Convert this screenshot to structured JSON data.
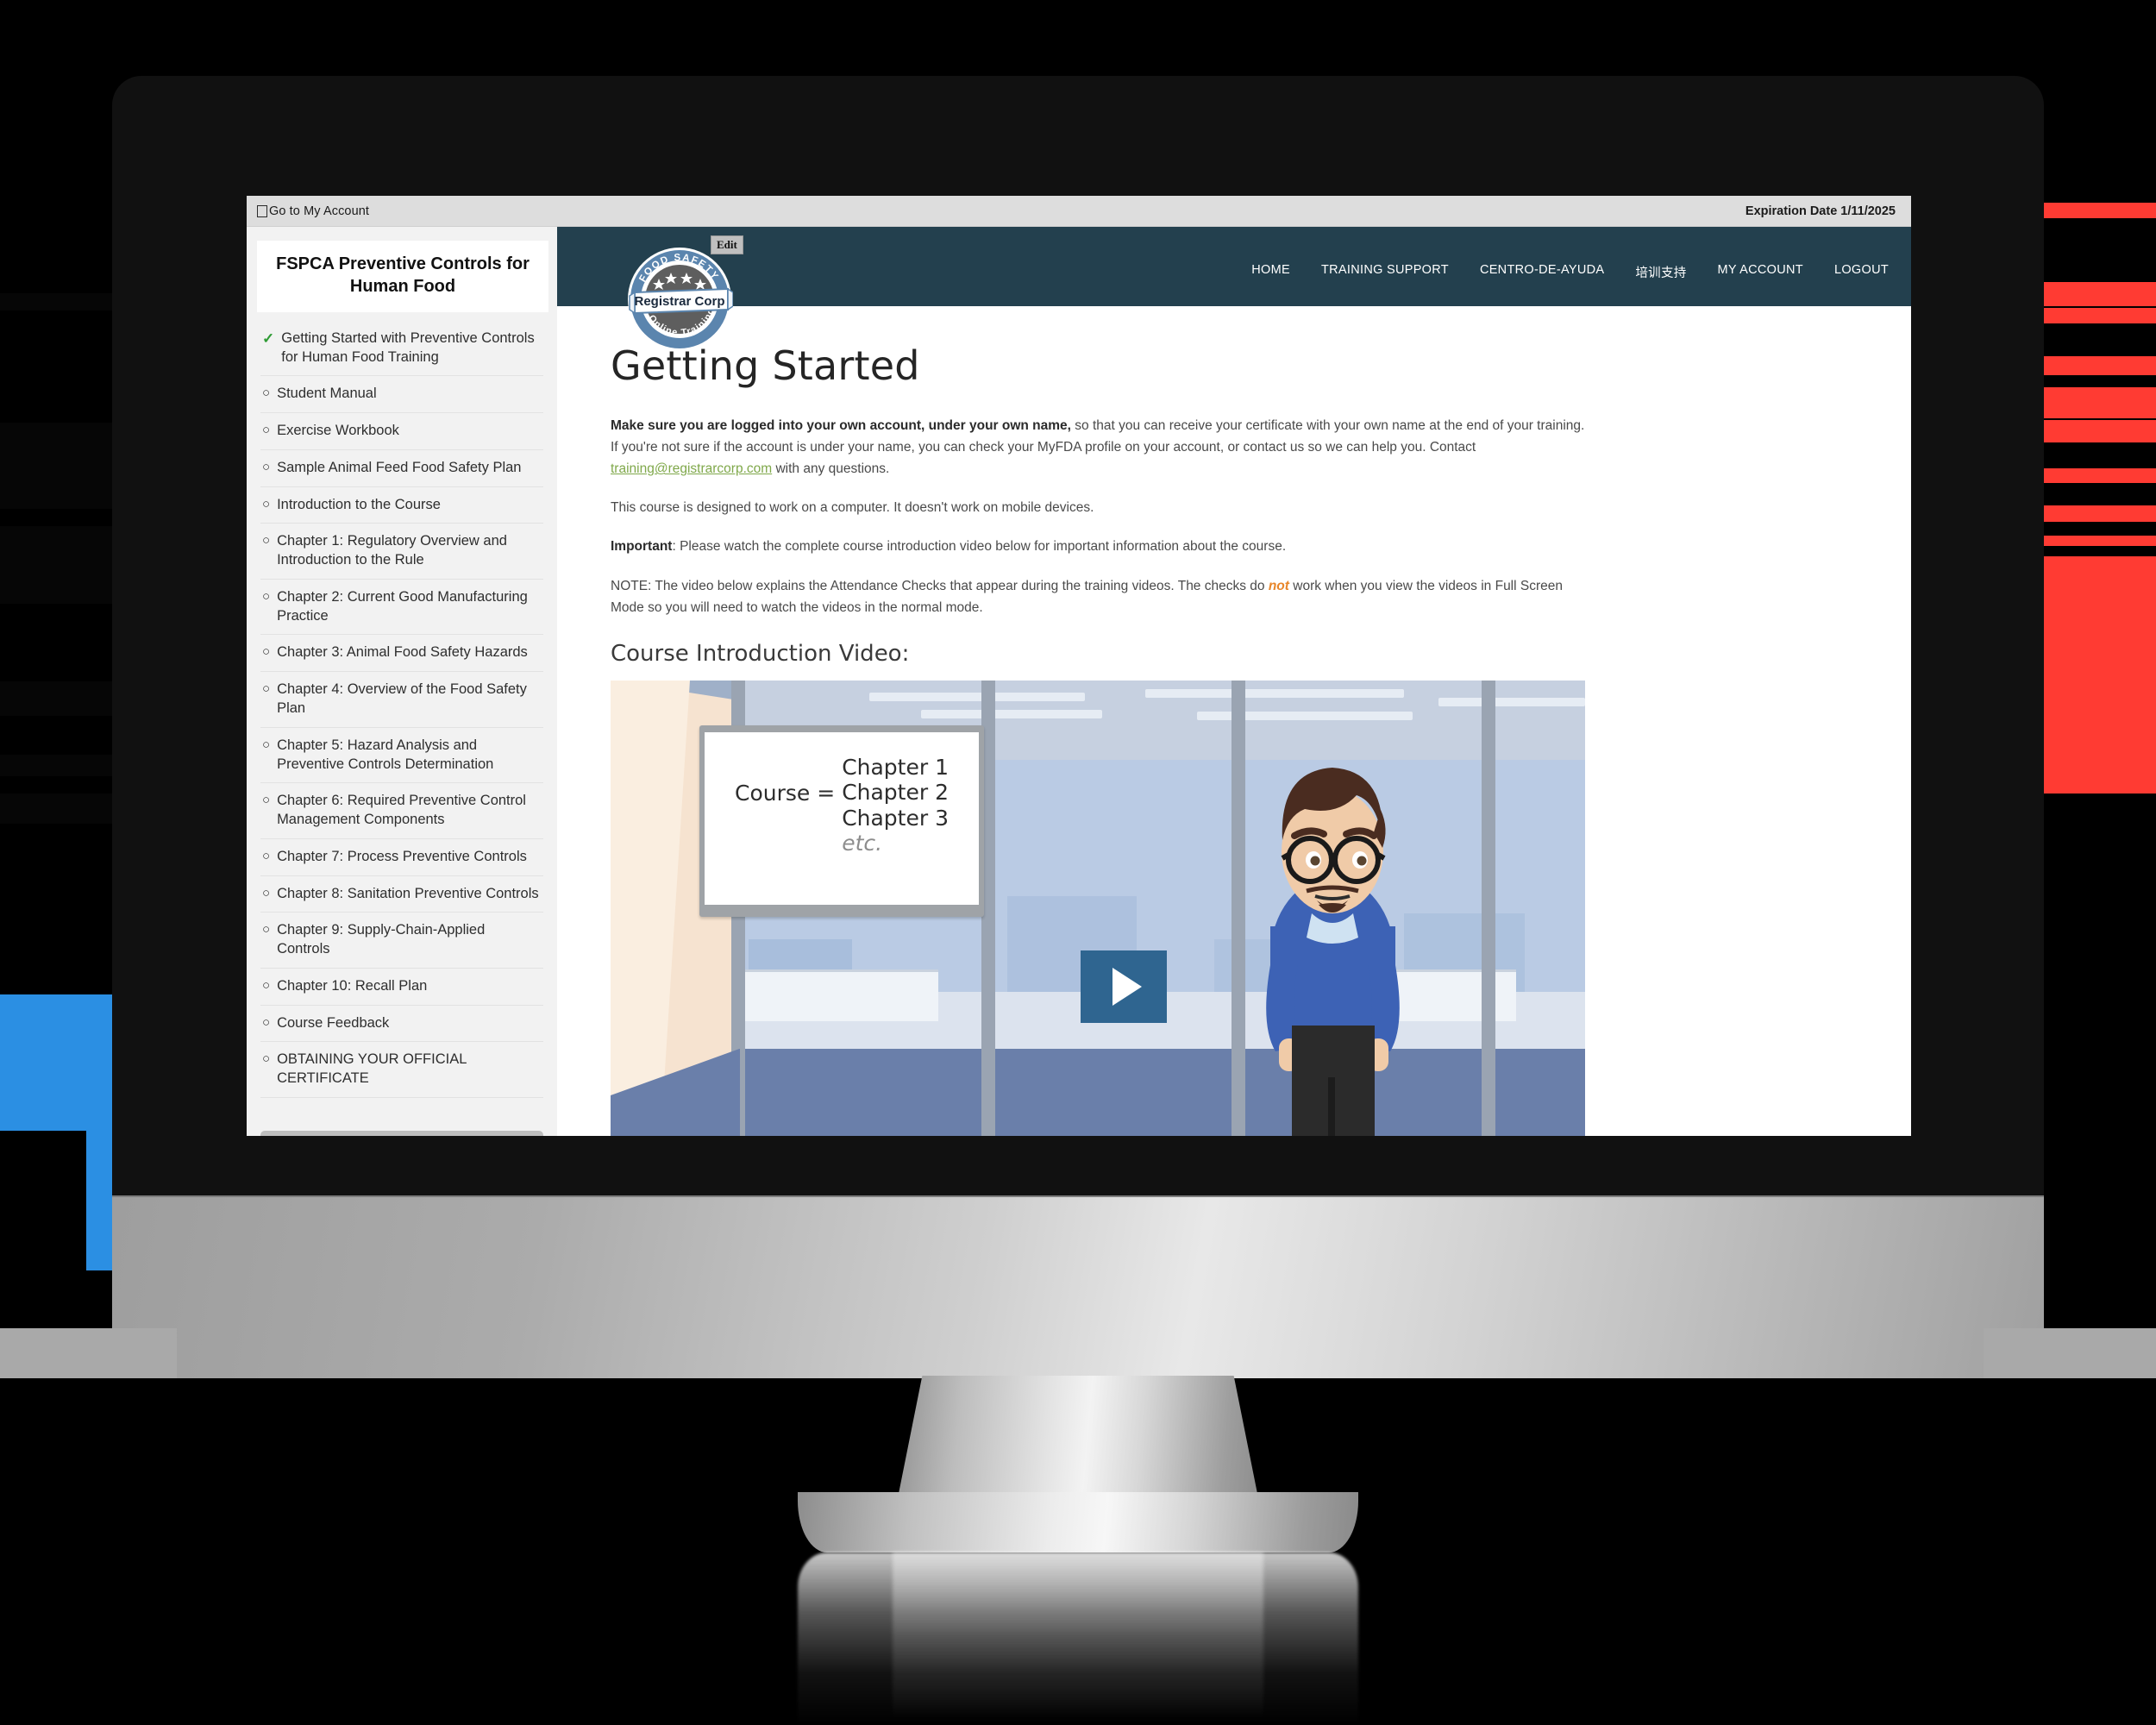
{
  "browser_bar": {
    "account_link": "Go to My Account",
    "account_checkbox_icon": "checkbox-icon",
    "expiration": "Expiration Date 1/11/2025"
  },
  "sidebar": {
    "title": "FSPCA Preventive Controls for Human Food",
    "items": [
      {
        "label": "Getting Started with Preventive Controls for Human Food Training",
        "status": "complete",
        "marker": "✓"
      },
      {
        "label": "Student Manual",
        "status": "incomplete",
        "marker": "○"
      },
      {
        "label": "Exercise Workbook",
        "status": "incomplete",
        "marker": "○"
      },
      {
        "label": "Sample Animal Feed Food Safety Plan",
        "status": "incomplete",
        "marker": "○"
      },
      {
        "label": "Introduction to the Course",
        "status": "incomplete",
        "marker": "○"
      },
      {
        "label": " Chapter 1: Regulatory Overview and Introduction to the Rule",
        "status": "incomplete",
        "marker": "○"
      },
      {
        "label": " Chapter 2: Current Good Manufacturing Practice",
        "status": "incomplete",
        "marker": "○"
      },
      {
        "label": "Chapter 3: Animal Food Safety Hazards",
        "status": "incomplete",
        "marker": "○"
      },
      {
        "label": "Chapter 4: Overview of the Food Safety Plan",
        "status": "incomplete",
        "marker": "○"
      },
      {
        "label": " Chapter 5: Hazard Analysis and Preventive Controls Determination",
        "status": "incomplete",
        "marker": "○"
      },
      {
        "label": " Chapter 6: Required Preventive Control Management Components",
        "status": "incomplete",
        "marker": "○"
      },
      {
        "label": "Chapter 7: Process Preventive Controls",
        "status": "incomplete",
        "marker": "○"
      },
      {
        "label": "Chapter 8: Sanitation Preventive Controls",
        "status": "incomplete",
        "marker": "○"
      },
      {
        "label": "Chapter 9: Supply-Chain-Applied Controls",
        "status": "incomplete",
        "marker": "○"
      },
      {
        "label": "Chapter 10: Recall Plan",
        "status": "incomplete",
        "marker": "○"
      },
      {
        "label": "Course Feedback",
        "status": "incomplete",
        "marker": "○"
      },
      {
        "label": "OBTAINING YOUR OFFICIAL CERTIFICATE",
        "status": "incomplete",
        "marker": "○"
      }
    ]
  },
  "site_header": {
    "edit_label": "Edit",
    "background_color": "#23404E",
    "logo": {
      "top_text": "FOOD SAFETY",
      "banner_text": "Registrar Corp",
      "bottom_text": "Online Training",
      "stars": 5
    },
    "nav": [
      {
        "label": "HOME"
      },
      {
        "label": "TRAINING SUPPORT"
      },
      {
        "label": "CENTRO-DE-AYUDA"
      },
      {
        "label": "培训支持"
      },
      {
        "label": "MY ACCOUNT"
      },
      {
        "label": "LOGOUT"
      }
    ]
  },
  "main": {
    "page_title": "Getting Started",
    "paragraph1": {
      "bold": "Make sure you are logged into your own account, under your own name,",
      "rest": " so that you can receive your certificate with your own name at the end of your training. If you're not sure if the account is under your name, you can check your MyFDA profile on your account, or contact us so we can help you. Contact ",
      "email": "training@registrarcorp.com",
      "tail": " with any questions."
    },
    "paragraph2": "This course is designed to work on a computer. It doesn't work on mobile devices.",
    "paragraph3": {
      "bold": "Important",
      "rest": ": Please watch the complete course introduction video below for important information about the course."
    },
    "paragraph4": {
      "pre": "NOTE: The video below explains the Attendance Checks that appear during the training videos. The checks do ",
      "emphasis": "not",
      "post": " work when you view the videos in Full Screen Mode so you will need to watch the videos in the normal mode."
    },
    "video_section_label": "Course Introduction Video:",
    "video": {
      "whiteboard": {
        "equation_label": "Course =",
        "lines": [
          "Chapter 1",
          "Chapter 2",
          "Chapter 3",
          "etc."
        ]
      },
      "play_button_icon": "play-icon",
      "play_button_color": "#2F6590"
    }
  },
  "colors": {
    "header_navy": "#23404E",
    "accent_green": "#7FA84A",
    "accent_orange": "#E8862A",
    "check_green": "#2E9B34",
    "deco_red": "#FF3B33",
    "deco_blue": "#2B8FE3"
  }
}
